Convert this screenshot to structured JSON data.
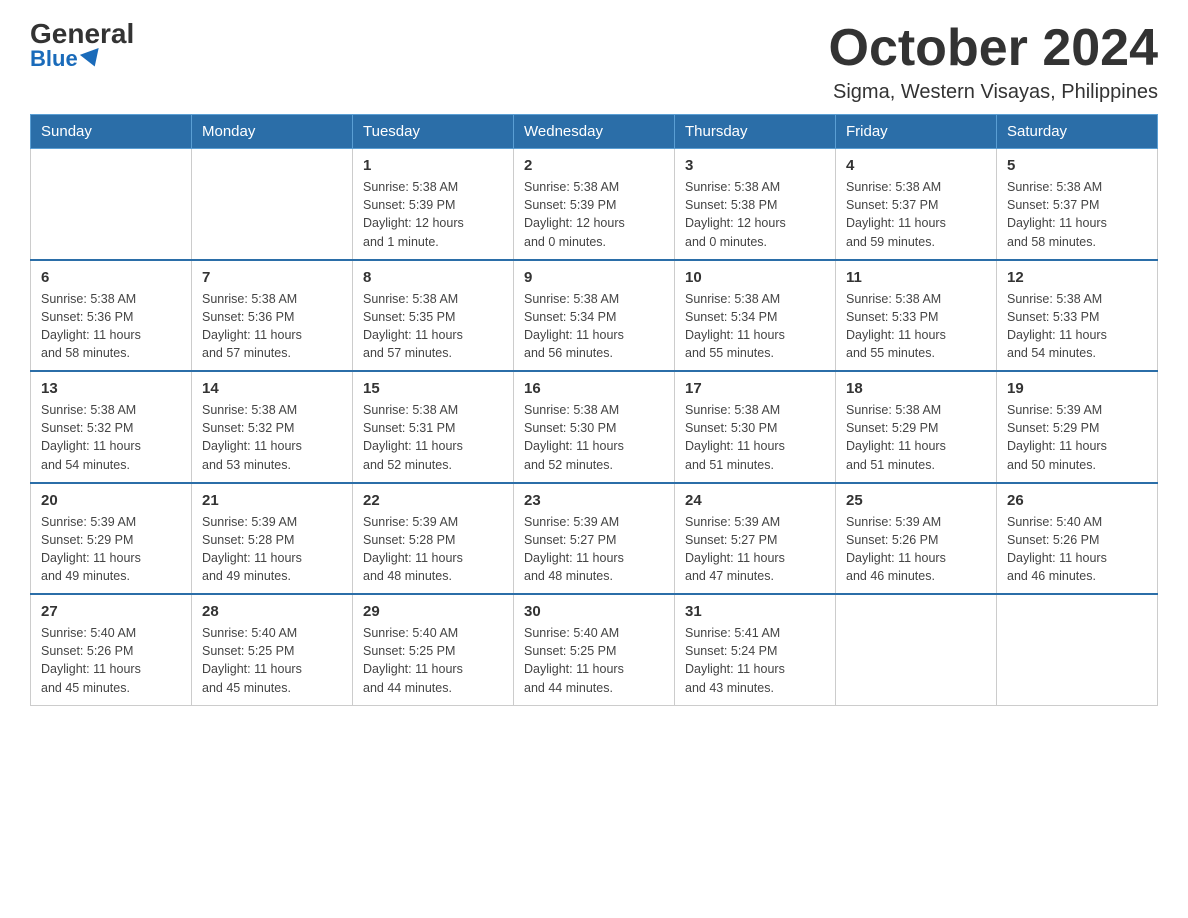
{
  "logo": {
    "general": "General",
    "blue": "Blue"
  },
  "title": "October 2024",
  "location": "Sigma, Western Visayas, Philippines",
  "days_of_week": [
    "Sunday",
    "Monday",
    "Tuesday",
    "Wednesday",
    "Thursday",
    "Friday",
    "Saturday"
  ],
  "weeks": [
    [
      {
        "day": "",
        "info": ""
      },
      {
        "day": "",
        "info": ""
      },
      {
        "day": "1",
        "info": "Sunrise: 5:38 AM\nSunset: 5:39 PM\nDaylight: 12 hours\nand 1 minute."
      },
      {
        "day": "2",
        "info": "Sunrise: 5:38 AM\nSunset: 5:39 PM\nDaylight: 12 hours\nand 0 minutes."
      },
      {
        "day": "3",
        "info": "Sunrise: 5:38 AM\nSunset: 5:38 PM\nDaylight: 12 hours\nand 0 minutes."
      },
      {
        "day": "4",
        "info": "Sunrise: 5:38 AM\nSunset: 5:37 PM\nDaylight: 11 hours\nand 59 minutes."
      },
      {
        "day": "5",
        "info": "Sunrise: 5:38 AM\nSunset: 5:37 PM\nDaylight: 11 hours\nand 58 minutes."
      }
    ],
    [
      {
        "day": "6",
        "info": "Sunrise: 5:38 AM\nSunset: 5:36 PM\nDaylight: 11 hours\nand 58 minutes."
      },
      {
        "day": "7",
        "info": "Sunrise: 5:38 AM\nSunset: 5:36 PM\nDaylight: 11 hours\nand 57 minutes."
      },
      {
        "day": "8",
        "info": "Sunrise: 5:38 AM\nSunset: 5:35 PM\nDaylight: 11 hours\nand 57 minutes."
      },
      {
        "day": "9",
        "info": "Sunrise: 5:38 AM\nSunset: 5:34 PM\nDaylight: 11 hours\nand 56 minutes."
      },
      {
        "day": "10",
        "info": "Sunrise: 5:38 AM\nSunset: 5:34 PM\nDaylight: 11 hours\nand 55 minutes."
      },
      {
        "day": "11",
        "info": "Sunrise: 5:38 AM\nSunset: 5:33 PM\nDaylight: 11 hours\nand 55 minutes."
      },
      {
        "day": "12",
        "info": "Sunrise: 5:38 AM\nSunset: 5:33 PM\nDaylight: 11 hours\nand 54 minutes."
      }
    ],
    [
      {
        "day": "13",
        "info": "Sunrise: 5:38 AM\nSunset: 5:32 PM\nDaylight: 11 hours\nand 54 minutes."
      },
      {
        "day": "14",
        "info": "Sunrise: 5:38 AM\nSunset: 5:32 PM\nDaylight: 11 hours\nand 53 minutes."
      },
      {
        "day": "15",
        "info": "Sunrise: 5:38 AM\nSunset: 5:31 PM\nDaylight: 11 hours\nand 52 minutes."
      },
      {
        "day": "16",
        "info": "Sunrise: 5:38 AM\nSunset: 5:30 PM\nDaylight: 11 hours\nand 52 minutes."
      },
      {
        "day": "17",
        "info": "Sunrise: 5:38 AM\nSunset: 5:30 PM\nDaylight: 11 hours\nand 51 minutes."
      },
      {
        "day": "18",
        "info": "Sunrise: 5:38 AM\nSunset: 5:29 PM\nDaylight: 11 hours\nand 51 minutes."
      },
      {
        "day": "19",
        "info": "Sunrise: 5:39 AM\nSunset: 5:29 PM\nDaylight: 11 hours\nand 50 minutes."
      }
    ],
    [
      {
        "day": "20",
        "info": "Sunrise: 5:39 AM\nSunset: 5:29 PM\nDaylight: 11 hours\nand 49 minutes."
      },
      {
        "day": "21",
        "info": "Sunrise: 5:39 AM\nSunset: 5:28 PM\nDaylight: 11 hours\nand 49 minutes."
      },
      {
        "day": "22",
        "info": "Sunrise: 5:39 AM\nSunset: 5:28 PM\nDaylight: 11 hours\nand 48 minutes."
      },
      {
        "day": "23",
        "info": "Sunrise: 5:39 AM\nSunset: 5:27 PM\nDaylight: 11 hours\nand 48 minutes."
      },
      {
        "day": "24",
        "info": "Sunrise: 5:39 AM\nSunset: 5:27 PM\nDaylight: 11 hours\nand 47 minutes."
      },
      {
        "day": "25",
        "info": "Sunrise: 5:39 AM\nSunset: 5:26 PM\nDaylight: 11 hours\nand 46 minutes."
      },
      {
        "day": "26",
        "info": "Sunrise: 5:40 AM\nSunset: 5:26 PM\nDaylight: 11 hours\nand 46 minutes."
      }
    ],
    [
      {
        "day": "27",
        "info": "Sunrise: 5:40 AM\nSunset: 5:26 PM\nDaylight: 11 hours\nand 45 minutes."
      },
      {
        "day": "28",
        "info": "Sunrise: 5:40 AM\nSunset: 5:25 PM\nDaylight: 11 hours\nand 45 minutes."
      },
      {
        "day": "29",
        "info": "Sunrise: 5:40 AM\nSunset: 5:25 PM\nDaylight: 11 hours\nand 44 minutes."
      },
      {
        "day": "30",
        "info": "Sunrise: 5:40 AM\nSunset: 5:25 PM\nDaylight: 11 hours\nand 44 minutes."
      },
      {
        "day": "31",
        "info": "Sunrise: 5:41 AM\nSunset: 5:24 PM\nDaylight: 11 hours\nand 43 minutes."
      },
      {
        "day": "",
        "info": ""
      },
      {
        "day": "",
        "info": ""
      }
    ]
  ]
}
